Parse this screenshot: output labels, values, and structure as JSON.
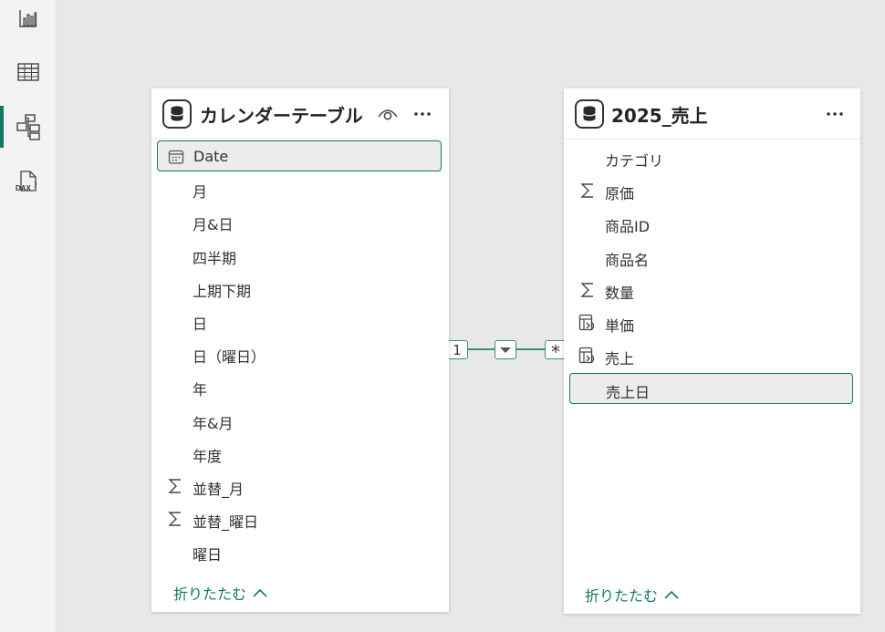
{
  "nav_rail": {
    "items": [
      {
        "name": "report-view",
        "icon": "bar-chart-icon",
        "active": false
      },
      {
        "name": "table-view",
        "icon": "grid-table-icon",
        "active": false
      },
      {
        "name": "model-view",
        "icon": "model-diagram-icon",
        "active": true
      },
      {
        "name": "dax-query-view",
        "icon": "dax-query-icon",
        "active": false
      }
    ]
  },
  "calendar_table": {
    "title": "カレンダーテーブル",
    "fields": [
      {
        "label": "Date",
        "icon": "calendar-icon",
        "selected": true
      },
      {
        "label": "月",
        "icon": "",
        "selected": false
      },
      {
        "label": "月&日",
        "icon": "",
        "selected": false
      },
      {
        "label": "四半期",
        "icon": "",
        "selected": false
      },
      {
        "label": "上期下期",
        "icon": "",
        "selected": false
      },
      {
        "label": "日",
        "icon": "",
        "selected": false
      },
      {
        "label": "日（曜日）",
        "icon": "",
        "selected": false
      },
      {
        "label": "年",
        "icon": "",
        "selected": false
      },
      {
        "label": "年&月",
        "icon": "",
        "selected": false
      },
      {
        "label": "年度",
        "icon": "",
        "selected": false
      },
      {
        "label": "並替_月",
        "icon": "sigma-icon",
        "selected": false
      },
      {
        "label": "並替_曜日",
        "icon": "sigma-icon",
        "selected": false
      },
      {
        "label": "曜日",
        "icon": "",
        "selected": false
      }
    ],
    "collapse_label": "折りたたむ"
  },
  "sales_table": {
    "title": "2025_売上",
    "fields": [
      {
        "label": "カテゴリ",
        "icon": "",
        "selected": false
      },
      {
        "label": "原価",
        "icon": "sigma-icon",
        "selected": false
      },
      {
        "label": "商品ID",
        "icon": "",
        "selected": false
      },
      {
        "label": "商品名",
        "icon": "",
        "selected": false
      },
      {
        "label": "数量",
        "icon": "sigma-icon",
        "selected": false
      },
      {
        "label": "単価",
        "icon": "calculated-column-icon",
        "selected": false
      },
      {
        "label": "売上",
        "icon": "calculated-column-icon",
        "selected": false
      },
      {
        "label": "売上日",
        "icon": "",
        "selected": true
      }
    ],
    "collapse_label": "折りたたむ"
  },
  "relationship": {
    "from_cardinality": "1",
    "to_cardinality": "*",
    "filter_direction": "single"
  },
  "colors": {
    "accent": "#117865",
    "relationship_line": "#3a8f7c",
    "canvas": "#e8e8e8"
  }
}
